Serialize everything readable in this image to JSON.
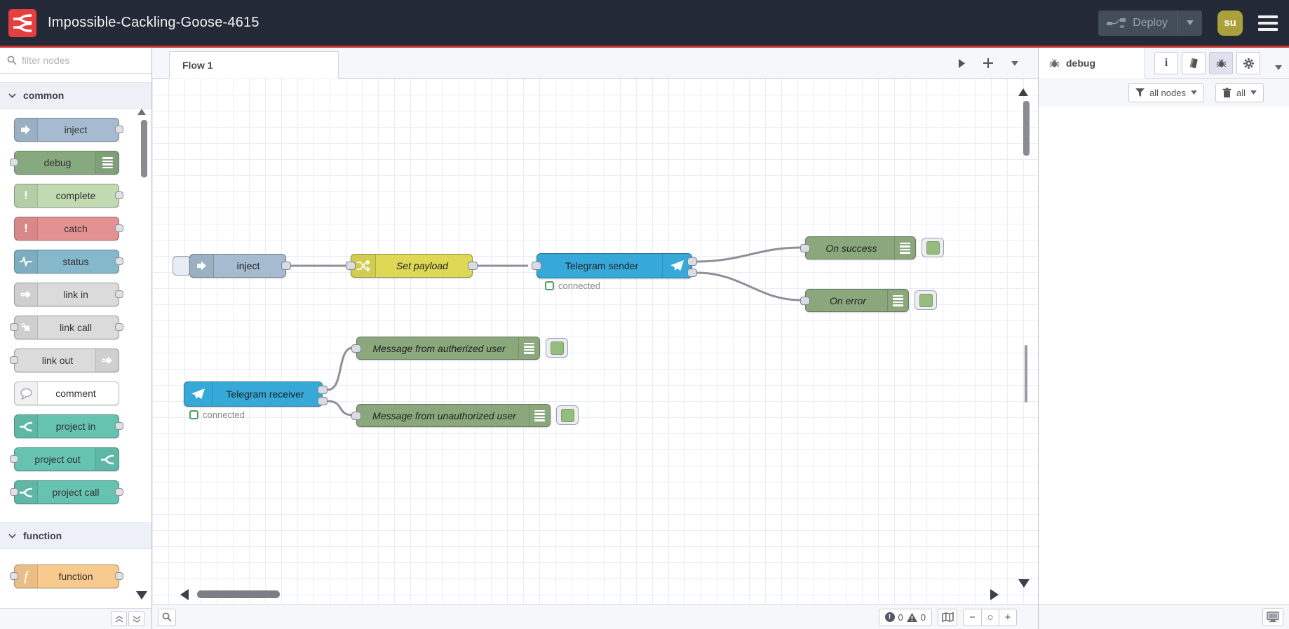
{
  "header": {
    "title": "Impossible-Cackling-Goose-4615",
    "deploy": {
      "label": "Deploy"
    },
    "avatar": {
      "initials": "su"
    }
  },
  "palette": {
    "search_placeholder": "filter nodes",
    "categories": [
      {
        "label": "common",
        "nodes": [
          {
            "label": "inject"
          },
          {
            "label": "debug"
          },
          {
            "label": "complete"
          },
          {
            "label": "catch"
          },
          {
            "label": "status"
          },
          {
            "label": "link in"
          },
          {
            "label": "link call"
          },
          {
            "label": "link out"
          },
          {
            "label": "comment"
          },
          {
            "label": "project in"
          },
          {
            "label": "project out"
          },
          {
            "label": "project call"
          }
        ]
      },
      {
        "label": "function",
        "nodes": [
          {
            "label": "function"
          }
        ]
      }
    ]
  },
  "workspace": {
    "tab_label": "Flow 1",
    "nodes": {
      "inject": {
        "label": "inject"
      },
      "set_payload": {
        "label": "Set payload"
      },
      "telegram_sender": {
        "label": "Telegram sender",
        "status": "connected"
      },
      "on_success": {
        "label": "On success"
      },
      "on_error": {
        "label": "On error"
      },
      "telegram_receiver": {
        "label": "Telegram receiver",
        "status": "connected"
      },
      "msg_authorized": {
        "label": "Message from autherized user"
      },
      "msg_unauthorized": {
        "label": "Message from unauthorized user"
      }
    },
    "footer": {
      "errors": "0",
      "warnings": "0",
      "zoom_out": "−",
      "zoom_reset": "○",
      "zoom_in": "+"
    }
  },
  "sidebar": {
    "tab_label": "debug",
    "filter_button": "all nodes",
    "clear_button": "all"
  },
  "colors": {
    "header_bg": "#232937",
    "accent_red": "#c5302c",
    "logo_red": "#e5403f",
    "node_inject": "#a6bbcf",
    "node_debug_green": "#87a980",
    "node_complete": "#c0dab1",
    "node_catch": "#e49191",
    "node_status": "#86b8cc",
    "node_link": "#dbdbdb",
    "node_project": "#65c3b0",
    "node_function": "#f8ca8d",
    "node_change": "#ded955",
    "node_telegram": "#36a9d9",
    "wire": "#8f9098",
    "status_green": "#48a15f",
    "avatar_bg": "#aaa13c"
  }
}
